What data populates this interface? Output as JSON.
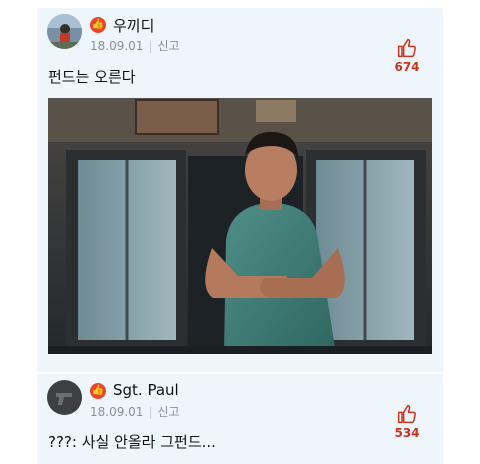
{
  "comments": [
    {
      "author": "우끼디",
      "date": "18.09.01",
      "report_label": "신고",
      "text": "펀드는 오른다",
      "likes": "674",
      "has_image": true,
      "badge_icon": "thumbs-up-badge-icon"
    },
    {
      "author": "Sgt. Paul",
      "date": "18.09.01",
      "report_label": "신고",
      "text": "???: 사실 안올라 그펀드...",
      "likes": "534",
      "has_image": false,
      "badge_icon": "thumbs-up-badge-icon"
    }
  ],
  "colors": {
    "card_bg": "#eef5fb",
    "like_red": "#c8341e",
    "badge_red": "#e8462f",
    "meta_gray": "#8a8f96"
  }
}
